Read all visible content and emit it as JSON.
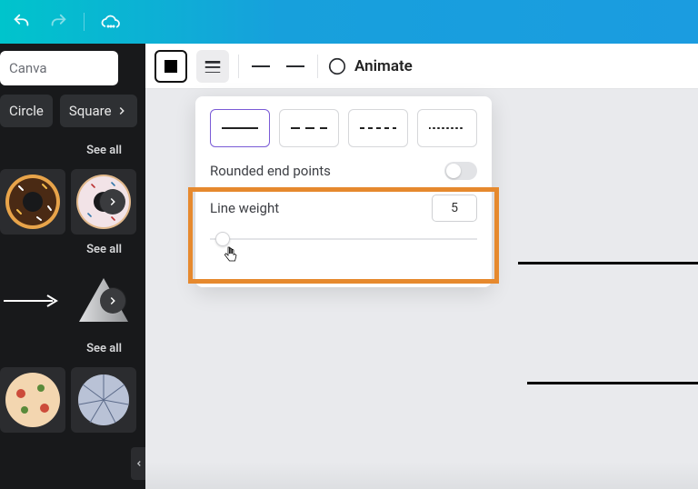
{
  "topbar": {
    "undo_icon": "undo",
    "redo_icon": "redo",
    "cloud_icon": "cloud"
  },
  "sidebar": {
    "search_placeholder": "Canva",
    "chips": [
      "Circle",
      "Square"
    ],
    "see_all_label": "See all"
  },
  "toolbar": {
    "animate_label": "Animate"
  },
  "panel": {
    "rounded_label": "Rounded end points",
    "rounded_on": false,
    "line_weight_label": "Line weight",
    "line_weight_value": "5",
    "styles": [
      {
        "id": "solid",
        "selected": true
      },
      {
        "id": "long-dash",
        "selected": false
      },
      {
        "id": "short-dash",
        "selected": false
      },
      {
        "id": "dotted",
        "selected": false
      }
    ]
  }
}
